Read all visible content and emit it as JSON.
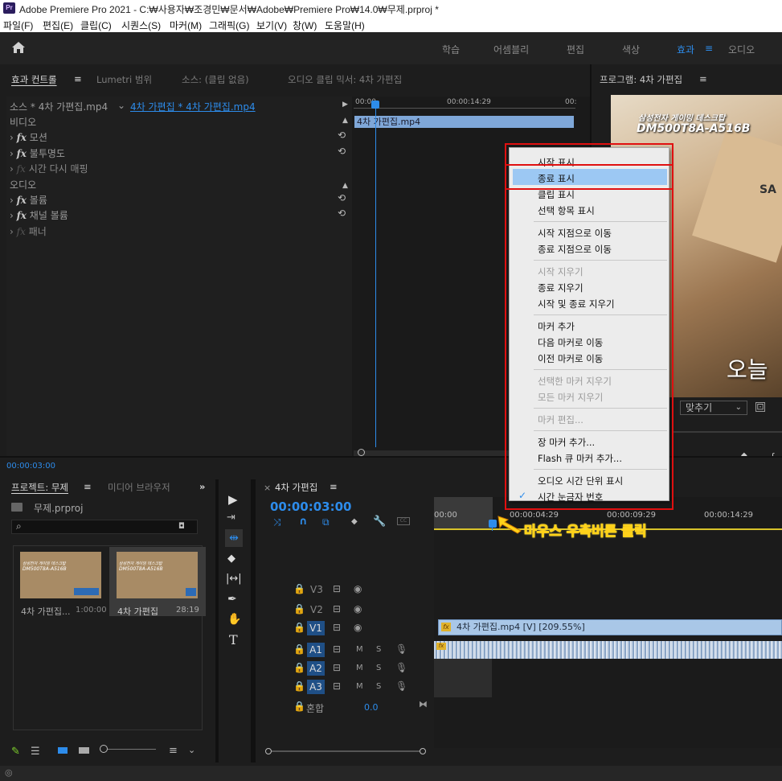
{
  "window": {
    "app_badge": "Pr",
    "title": "Adobe Premiere Pro 2021 - C:₩사용자₩조경민₩문서₩Adobe₩Premiere Pro₩14.0₩무제.prproj *"
  },
  "menu": [
    "파일(F)",
    "편집(E)",
    "클립(C)",
    "시퀀스(S)",
    "마커(M)",
    "그래픽(G)",
    "보기(V)",
    "창(W)",
    "도움말(H)"
  ],
  "workspaces": {
    "learn": "학습",
    "assembly": "어셈블리",
    "edit": "편집",
    "color": "색상",
    "effects": "효과",
    "effects_menu": "≡",
    "audio": "오디오"
  },
  "panels": {
    "effect_controls": "효과 컨트롤",
    "effect_controls_menu": "≡",
    "lumetri": "Lumetri 범위",
    "source": "소스: (클립 없음)",
    "audio_mixer": "오디오 클립 믹서: 4차 가편집",
    "program": "프로그램: 4차 가편집",
    "program_menu": "≡"
  },
  "effect_controls": {
    "source_label": "소스 * 4차 가편집.mp4",
    "seq_clip": "4차 가편집 * 4차 가편집.mp4",
    "ruler": [
      "00:00",
      "00:00:14:29",
      "00:"
    ],
    "clip_name": "4차 가편집.mp4",
    "rows": [
      {
        "label": "비디오",
        "kind": "section"
      },
      {
        "label": "모션",
        "kind": "fx",
        "reset": "⟲"
      },
      {
        "label": "불투명도",
        "kind": "fx",
        "reset": "⟲"
      },
      {
        "label": "시간 다시 매핑",
        "kind": "fxdim"
      },
      {
        "label": "오디오",
        "kind": "section"
      },
      {
        "label": "볼륨",
        "kind": "fx",
        "reset": "⟲"
      },
      {
        "label": "채널 볼륨",
        "kind": "fx",
        "reset": "⟲"
      },
      {
        "label": "패너",
        "kind": "fxdim"
      }
    ],
    "timecode": "00:00:03:00"
  },
  "program": {
    "overlay_line1": "삼성전자 게이밍 데스크탑",
    "overlay_line2": "DM500T8A-A516B",
    "caption": "오늘",
    "zoom": "맞추기",
    "side_text": "SA"
  },
  "context_menu": {
    "items": [
      {
        "label": "시작 표시",
        "state": "normal"
      },
      {
        "label": "종료 표시",
        "state": "highlight"
      },
      {
        "label": "클립 표시",
        "state": "normal"
      },
      {
        "label": "선택 항목 표시",
        "state": "normal"
      },
      {
        "sep": true
      },
      {
        "label": "시작 지점으로 이동",
        "state": "normal"
      },
      {
        "label": "종료 지점으로 이동",
        "state": "normal"
      },
      {
        "sep": true
      },
      {
        "label": "시작 지우기",
        "state": "disabled"
      },
      {
        "label": "종료 지우기",
        "state": "normal"
      },
      {
        "label": "시작 및 종료 지우기",
        "state": "normal"
      },
      {
        "sep": true
      },
      {
        "label": "마커 추가",
        "state": "normal"
      },
      {
        "label": "다음 마커로 이동",
        "state": "normal"
      },
      {
        "label": "이전 마커로 이동",
        "state": "normal"
      },
      {
        "sep": true
      },
      {
        "label": "선택한 마커 지우기",
        "state": "disabled"
      },
      {
        "label": "모든 마커 지우기",
        "state": "disabled"
      },
      {
        "sep": true
      },
      {
        "label": "마커 편집...",
        "state": "disabled"
      },
      {
        "sep": true
      },
      {
        "label": "장 마커 추가...",
        "state": "normal"
      },
      {
        "label": "Flash 큐 마커 추가...",
        "state": "normal"
      },
      {
        "sep": true
      },
      {
        "label": "오디오 시간 단위 표시",
        "state": "normal"
      },
      {
        "label": "시간 눈금자 번호",
        "state": "checked"
      }
    ]
  },
  "annotation": "마우스 우측버튼 클릭",
  "project": {
    "tab": "프로젝트: 무제",
    "tab_menu": "≡",
    "media_browser": "미디어 브라우저",
    "more": "»",
    "file": "무제.prproj",
    "thumb_text1": "삼성전자 게이밍 데스크탑",
    "thumb_text2": "DM500T8A-A516B",
    "items": [
      {
        "name": "4차 가편집...",
        "duration": "1:00:00"
      },
      {
        "name": "4차 가편집",
        "duration": "28:19"
      }
    ]
  },
  "sequence": {
    "tab": "4차 가편집",
    "tab_close": "×",
    "tab_menu": "≡",
    "timecode": "00:00:03:00",
    "ruler": [
      "00:00",
      "00:00:04:29",
      "00:00:09:29",
      "00:00:14:29"
    ],
    "video_tracks": [
      "V3",
      "V2",
      "V1"
    ],
    "audio_tracks": [
      "A1",
      "A2",
      "A3"
    ],
    "mix_label": "혼합",
    "mix_value": "0.0",
    "clip_label": "4차 가편집.mp4 [V] [209.55%]",
    "ms": "M",
    "ss": "S"
  },
  "colors": {
    "accent": "#2d8ceb",
    "timecode": "#2d8ceb",
    "highlight": "#9cc8f3",
    "red": "#e01010",
    "annotation_fill": "#ff2e9a"
  }
}
